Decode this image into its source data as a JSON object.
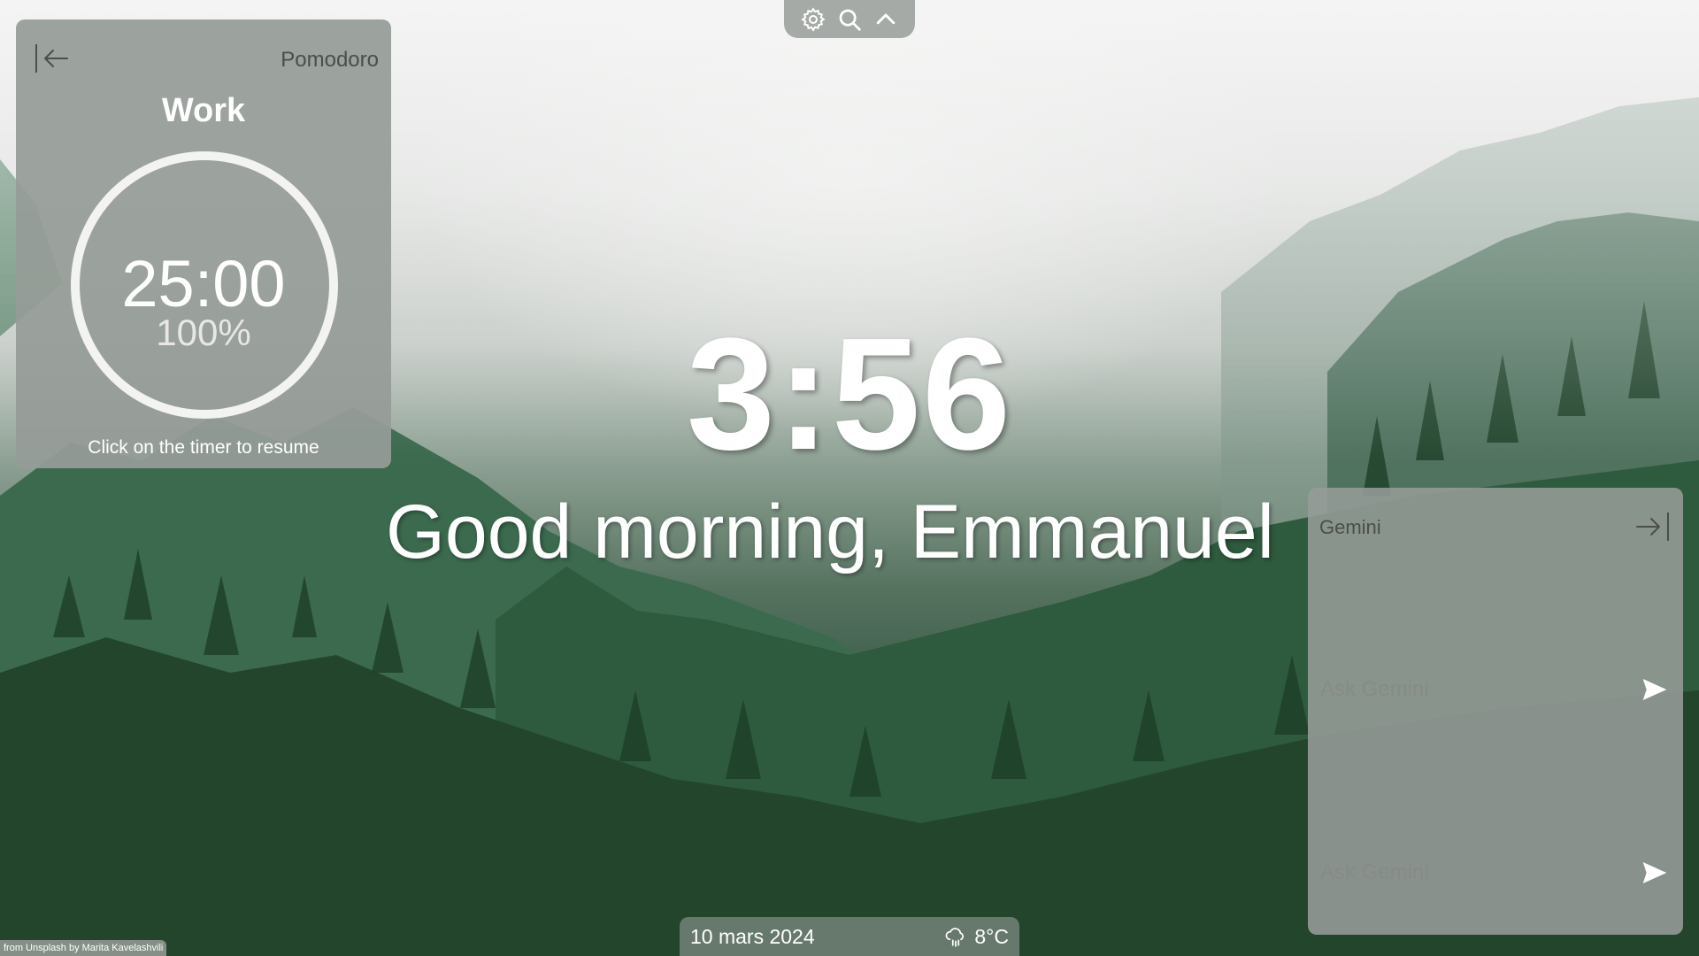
{
  "toolbar": {
    "icons": [
      "gear-icon",
      "search-icon",
      "chevron-up-icon"
    ]
  },
  "pomodoro": {
    "title": "Pomodoro",
    "mode": "Work",
    "time": "25:00",
    "percent": "100%",
    "hint": "Click on the timer to resume",
    "progress_fraction": 1.0
  },
  "clock": {
    "time": "3:56"
  },
  "greeting": {
    "text": "Good morning, Emmanuel"
  },
  "gemini": {
    "title": "Gemini",
    "input_placeholder": "Ask Gemini",
    "input_placeholder_2": "Ask Gemini"
  },
  "bottom_bar": {
    "date": "10 mars 2024",
    "temperature": "8°C",
    "weather_icon": "rain-cloud-icon"
  },
  "credit": {
    "text": "from Unsplash by Marita Kavelashvili"
  },
  "colors": {
    "panel": "#969c98",
    "text_white": "#ffffff",
    "muted_text": "#4b4e4c",
    "ring": "#f3f3f2"
  }
}
